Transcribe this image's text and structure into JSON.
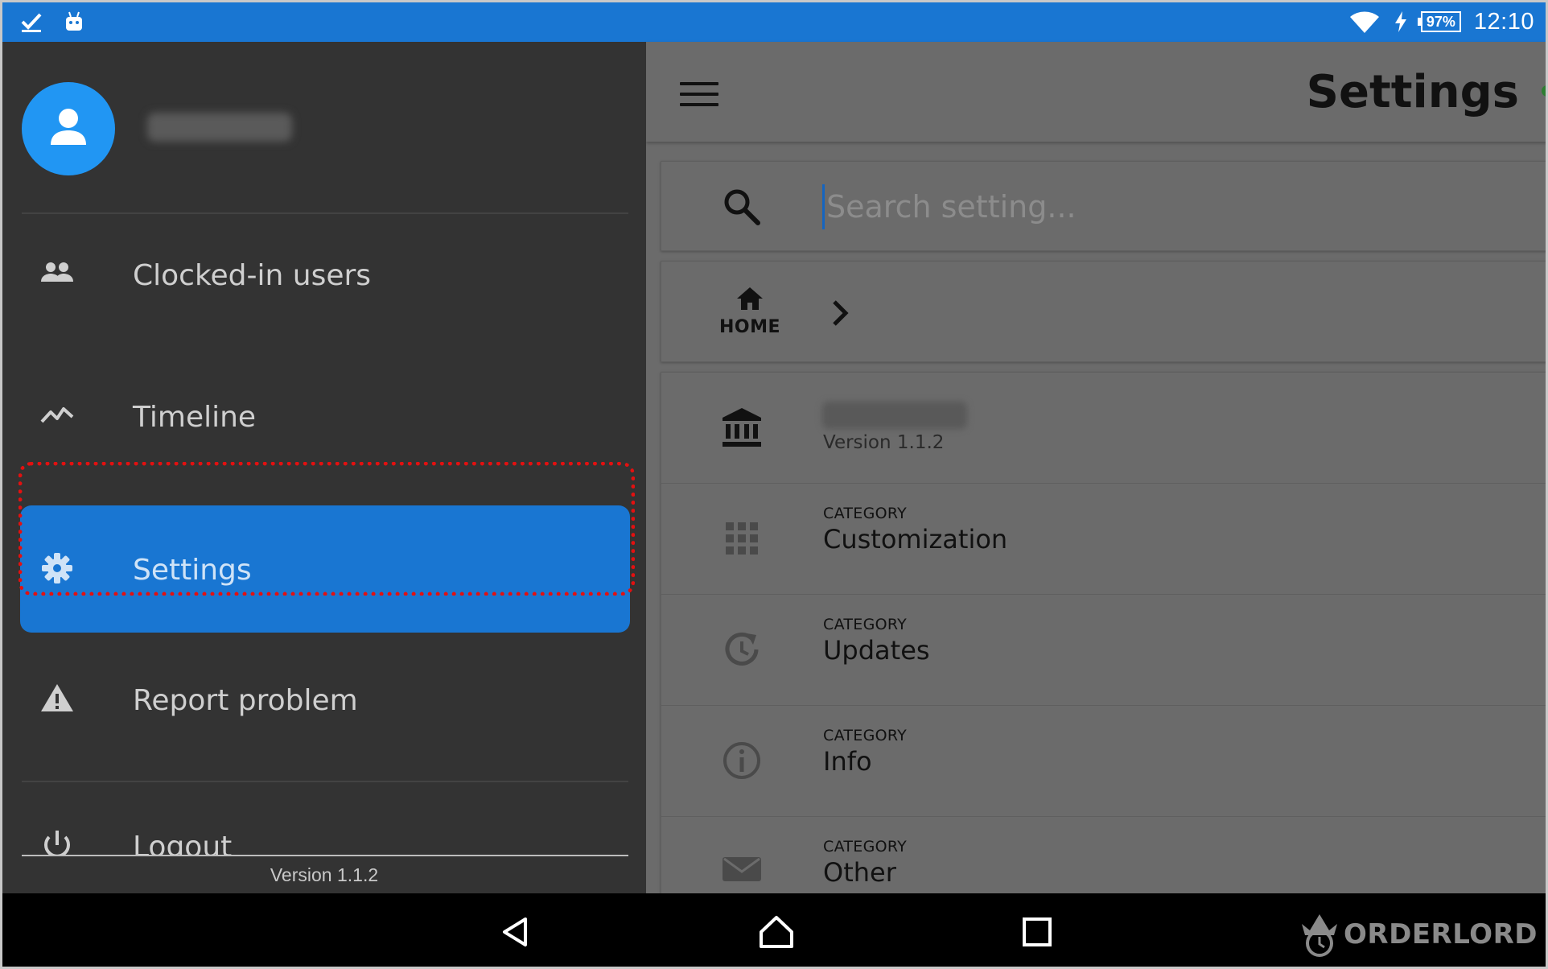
{
  "status_bar": {
    "battery": "97%",
    "time": "12:10"
  },
  "drawer": {
    "items": [
      {
        "label": "Clocked-in users",
        "icon": "group-icon"
      },
      {
        "label": "Timeline",
        "icon": "trending-icon"
      },
      {
        "label": "Settings",
        "icon": "gear-icon",
        "active": true
      },
      {
        "label": "Report problem",
        "icon": "warning-icon"
      },
      {
        "label": "Logout",
        "icon": "power-icon"
      }
    ],
    "version": "Version 1.1.2"
  },
  "header": {
    "title": "Settings"
  },
  "search": {
    "placeholder": "Search setting..."
  },
  "breadcrumb": {
    "home_label": "HOME"
  },
  "settings_list": {
    "account_subtitle": "Version 1.1.2",
    "categories": [
      {
        "caption": "CATEGORY",
        "title": "Customization",
        "icon": "grid-icon"
      },
      {
        "caption": "CATEGORY",
        "title": "Updates",
        "icon": "history-icon"
      },
      {
        "caption": "CATEGORY",
        "title": "Info",
        "icon": "info-icon"
      },
      {
        "caption": "CATEGORY",
        "title": "Other",
        "icon": "mail-icon"
      }
    ]
  },
  "watermark": {
    "brand": "ORDERLORD"
  },
  "colors": {
    "accent": "#1976d2",
    "drawer_bg": "#333333",
    "highlight": "#e31010"
  }
}
